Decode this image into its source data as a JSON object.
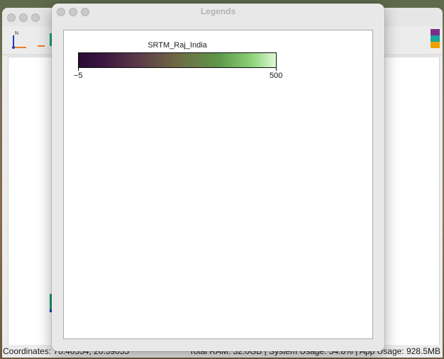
{
  "main_window": {
    "status": {
      "coordinates": "Coordinates: 70.40554, 20.59055",
      "system": "Total RAM: 32.0GB | System Usage: 54.8% | App Usage: 928.5MB"
    },
    "north_label": "N",
    "swatch_colors": [
      "#7b2f8a",
      "#1aa89a",
      "#f0a000"
    ]
  },
  "legends_window": {
    "title": "Legends",
    "legend": {
      "layer_name": "SRTM_Raj_India",
      "min_label": "−5",
      "max_label": "500",
      "colors": [
        "#2a0a33",
        "#5a3a48",
        "#6e6a44",
        "#5e9a4a",
        "#8ed37a",
        "#ddf8d6"
      ]
    }
  }
}
